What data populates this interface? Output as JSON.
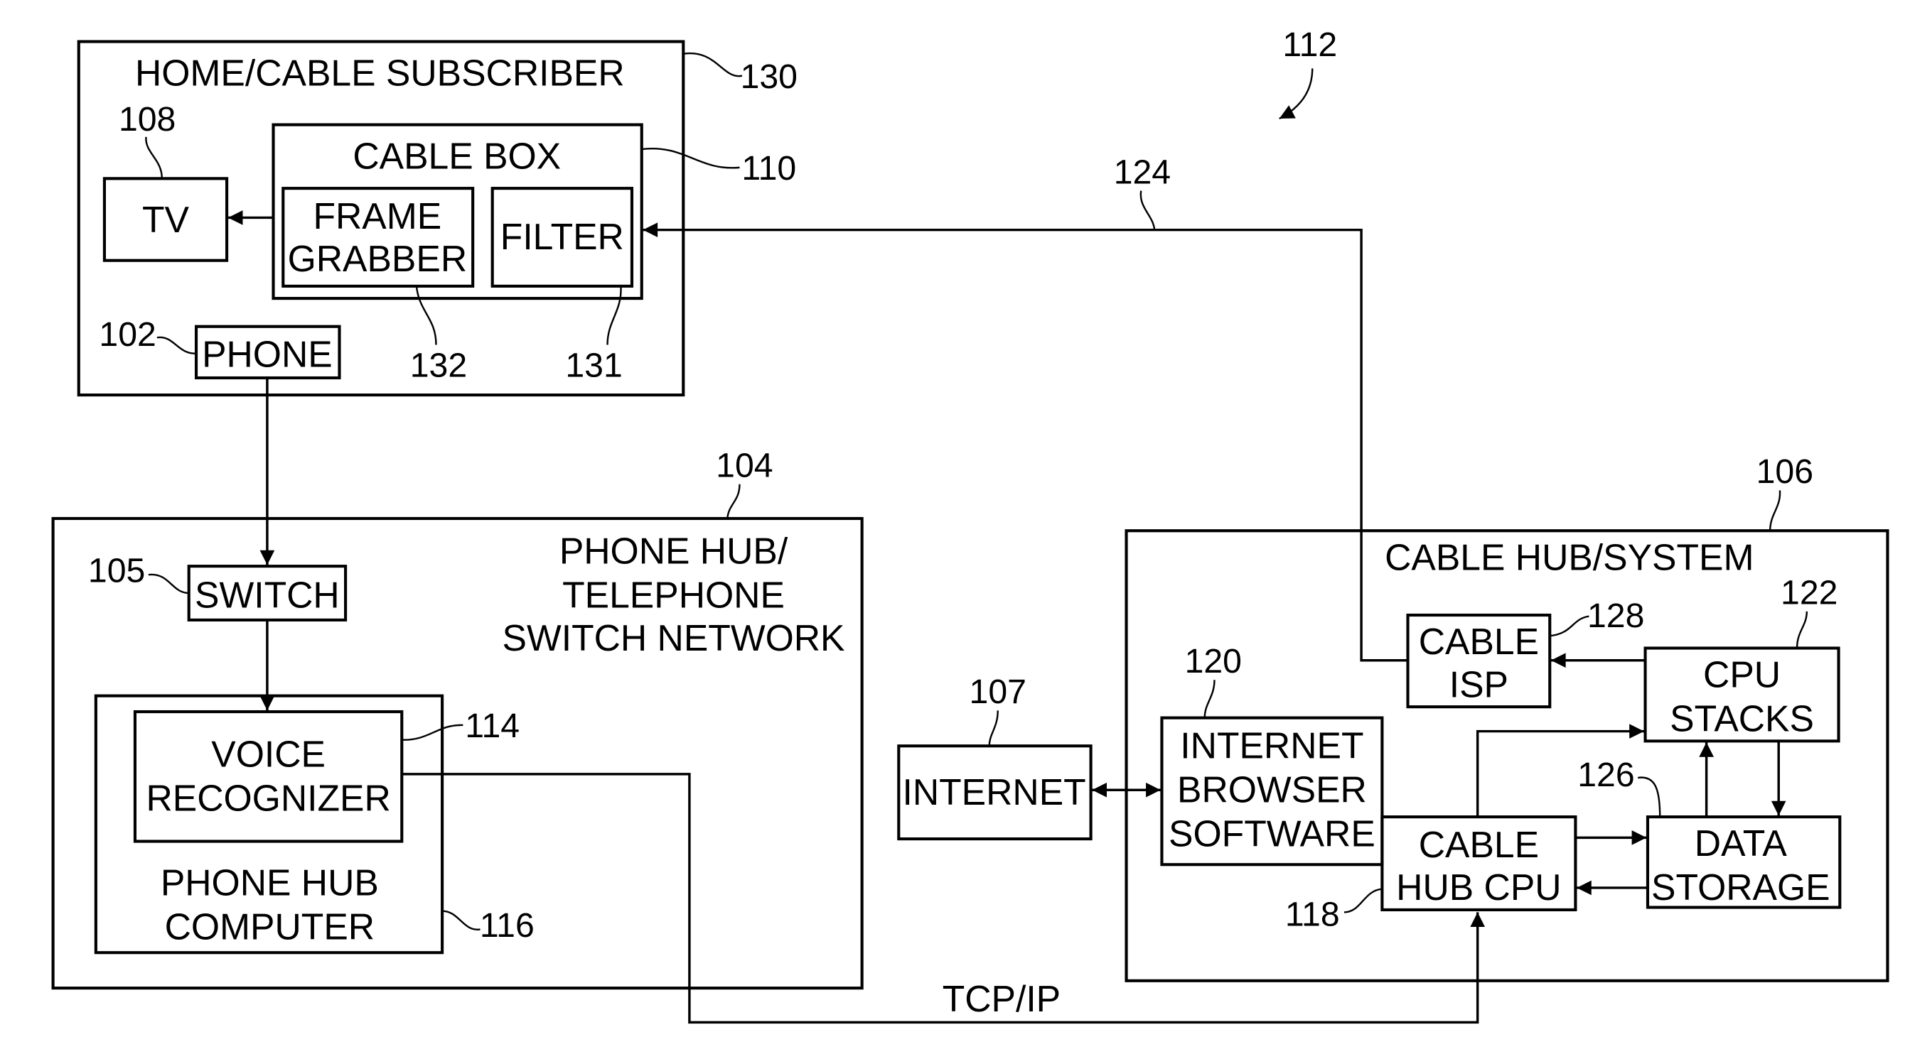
{
  "figure": {
    "reference": "112",
    "blocks": {
      "home_subscriber": {
        "title": "HOME/CABLE SUBSCRIBER",
        "ref": "130"
      },
      "tv": {
        "label": "TV",
        "ref": "108"
      },
      "cable_box": {
        "title": "CABLE BOX",
        "ref": "110"
      },
      "frame_grabber": {
        "lines": [
          "FRAME",
          "GRABBER"
        ],
        "ref": "132"
      },
      "filter": {
        "label": "FILTER",
        "ref": "131"
      },
      "phone": {
        "label": "PHONE",
        "ref": "102"
      },
      "phone_hub": {
        "lines": [
          "PHONE HUB/",
          "TELEPHONE",
          "SWITCH NETWORK"
        ],
        "ref": "104"
      },
      "switch": {
        "label": "SWITCH",
        "ref": "105"
      },
      "voice_recognizer": {
        "lines": [
          "VOICE",
          "RECOGNIZER"
        ],
        "ref": "114"
      },
      "phone_hub_computer": {
        "lines": [
          "PHONE HUB",
          "COMPUTER"
        ],
        "ref": "116"
      },
      "internet": {
        "label": "INTERNET",
        "ref": "107"
      },
      "cable_hub": {
        "title": "CABLE HUB/SYSTEM",
        "ref": "106"
      },
      "cable_isp": {
        "lines": [
          "CABLE",
          "ISP"
        ],
        "ref": "128"
      },
      "cpu_stacks": {
        "lines": [
          "CPU",
          "STACKS"
        ],
        "ref": "122"
      },
      "browser_software": {
        "lines": [
          "INTERNET",
          "BROWSER",
          "SOFTWARE"
        ],
        "ref": "120"
      },
      "cable_hub_cpu": {
        "lines": [
          "CABLE",
          "HUB CPU"
        ],
        "ref": "118"
      },
      "data_storage": {
        "lines": [
          "DATA",
          "STORAGE"
        ],
        "ref": "126"
      }
    },
    "connections": {
      "cable_link": {
        "ref": "124"
      },
      "tcpip": {
        "label": "TCP/IP"
      }
    }
  }
}
